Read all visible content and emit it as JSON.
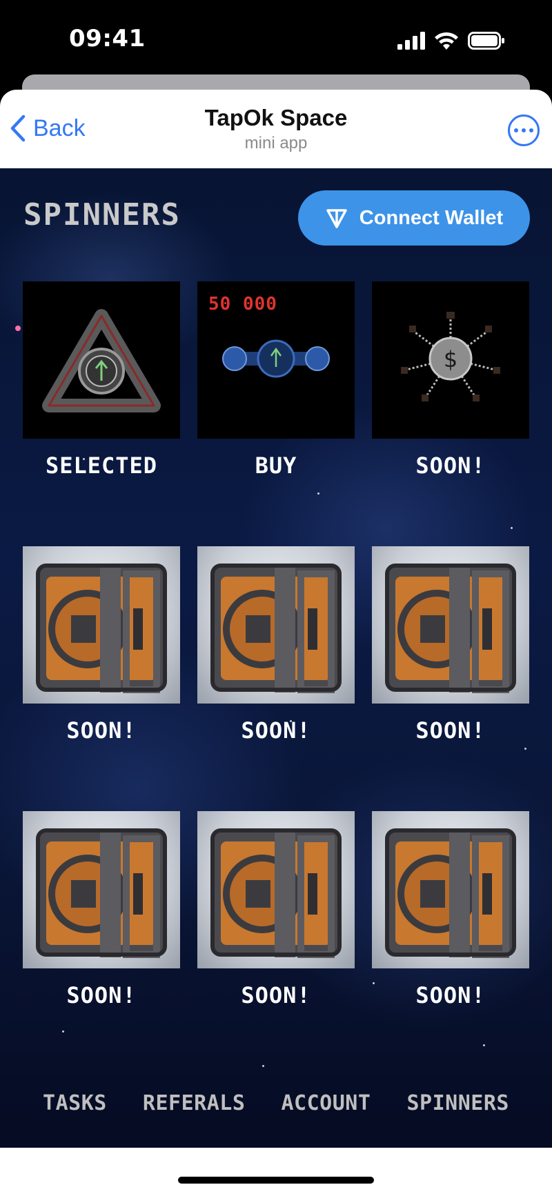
{
  "status_bar": {
    "time": "09:41"
  },
  "header": {
    "back_label": "Back",
    "title": "TapOk Space",
    "subtitle": "mini app"
  },
  "page": {
    "title": "SPINNERS",
    "wallet_button": "Connect Wallet"
  },
  "cards": [
    {
      "label": "SELECTED",
      "image": "triangle-spinner"
    },
    {
      "label": "BUY",
      "price": "50 000",
      "image": "bar-spinner"
    },
    {
      "label": "SOON!",
      "image": "dollar-spinner"
    },
    {
      "label": "SOON!",
      "image": "crate"
    },
    {
      "label": "SOON!",
      "image": "crate"
    },
    {
      "label": "SOON!",
      "image": "crate"
    },
    {
      "label": "SOON!",
      "image": "crate"
    },
    {
      "label": "SOON!",
      "image": "crate"
    },
    {
      "label": "SOON!",
      "image": "crate"
    }
  ],
  "nav": {
    "tasks": "TASKS",
    "referals": "REFERALS",
    "account": "ACCOUNT",
    "spinners": "SPINNERS"
  },
  "colors": {
    "accent": "#3d93e8",
    "link": "#3478f6",
    "price": "#e0342f"
  }
}
